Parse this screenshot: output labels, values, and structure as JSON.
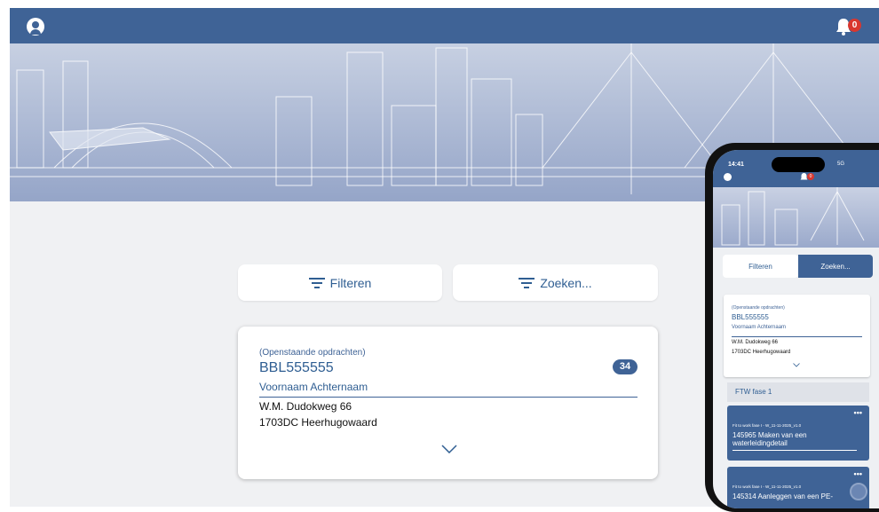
{
  "header": {
    "avatar_icon": "user-avatar-icon",
    "bell_icon": "bell-icon",
    "notification_count": "0"
  },
  "toolbar": {
    "filter_label": "Filteren",
    "search_label": "Zoeken..."
  },
  "card": {
    "category": "(Openstaande opdrachten)",
    "code": "BBL555555",
    "count": "34",
    "name": "Voornaam Achternaam",
    "address_line1": "W.M. Dudokweg 66",
    "address_line2": "1703DC Heerhugowaard"
  },
  "phone": {
    "time": "14:41",
    "signal": "5G",
    "notification_count": "0",
    "filter_label": "Filteren",
    "search_label": "Zoeken...",
    "card": {
      "category": "(Openstaande opdrachten)",
      "code": "BBL555555",
      "name": "Voornaam Achternaam",
      "address_line1": "W.M. Dudokweg 66",
      "address_line2": "1703DC Heerhugowaard"
    },
    "section_title": "FTW fase 1",
    "tasks": [
      {
        "menu": "•••",
        "subtitle": "Fit to work fase I - W_11-11-2025_v1.0",
        "title": "145965 Maken van een waterleidingdetail"
      },
      {
        "menu": "•••",
        "subtitle": "Fit to work fase I - W_11-11-2025_v1.0",
        "title": "145314 Aanleggen van een PE-"
      }
    ]
  },
  "colors": {
    "primary": "#3f6396",
    "accent_text": "#2f5e92",
    "badge": "#d9372f",
    "background": "#f0f1f3"
  }
}
